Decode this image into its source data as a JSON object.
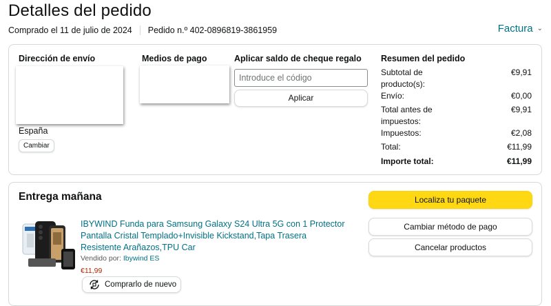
{
  "header": {
    "title": "Detalles del pedido",
    "ordered_on": "Comprado el 11 de julio de 2024",
    "order_number": "Pedido n.º 402-0896819-3861959",
    "invoice_label": "Factura"
  },
  "shipping": {
    "heading": "Dirección de envío",
    "country": "España",
    "change_label": "Cambiar"
  },
  "payment": {
    "heading": "Medios de pago"
  },
  "gift_card": {
    "heading": "Aplicar saldo de cheque regalo",
    "placeholder": "Introduce el código",
    "apply_label": "Aplicar"
  },
  "summary": {
    "heading": "Resumen del pedido",
    "rows": [
      {
        "label": "Subtotal de producto(s):",
        "value": "€9,91"
      },
      {
        "label": "Envío:",
        "value": "€0,00"
      },
      {
        "label": "Total antes de impuestos:",
        "value": "€9,91"
      },
      {
        "label": "Impuestos:",
        "value": "€2,08"
      },
      {
        "label": "Total:",
        "value": "€11,99"
      },
      {
        "label": "Importe total:",
        "value": "€11,99"
      }
    ]
  },
  "delivery": {
    "heading": "Entrega mañana",
    "track_label": "Localiza tu paquete",
    "change_payment_label": "Cambiar método de pago",
    "cancel_label": "Cancelar productos"
  },
  "product": {
    "title": "IBYWIND Funda para Samsung Galaxy S24 Ultra 5G con 1 Protector Pantalla Cristal Templado+Invisible Kickstand,Tapa Trasera Resistente Arañazos,TPU Car",
    "sold_by_label": "Vendido por:",
    "seller": "Ibywind ES",
    "price": "€11,99",
    "buy_again_label": "Comprarlo de nuevo"
  },
  "colors": {
    "link": "#007185",
    "price": "#b12704",
    "primary_button": "#ffd814"
  }
}
